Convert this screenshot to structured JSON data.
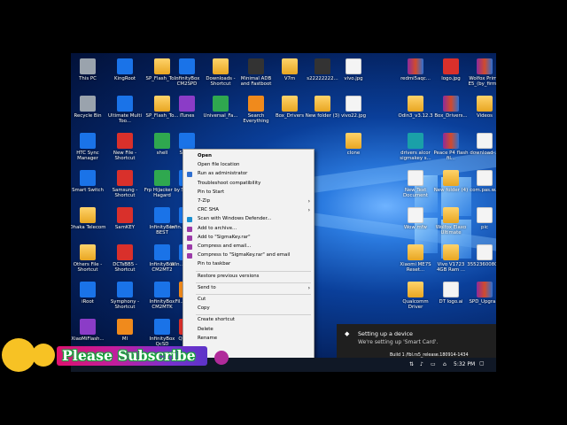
{
  "desktop_icons": [
    {
      "label": "This PC",
      "icon": "computer-icon",
      "style": "g-gray"
    },
    {
      "label": "KingRoot",
      "icon": "king-root-icon",
      "style": "g-blue"
    },
    {
      "label": "SP_Flash_To...",
      "icon": "folder-icon",
      "style": "g-folder"
    },
    {
      "label": "InfinityBox CM2SPD",
      "icon": "infinity-icon",
      "style": "g-blue"
    },
    {
      "label": "Downloads - Shortcut",
      "icon": "folder-icon",
      "style": "g-folder"
    },
    {
      "label": "Minimal ADB and Fastboot",
      "icon": "terminal-icon",
      "style": "g-dark"
    },
    {
      "label": "V7m",
      "icon": "folder-icon",
      "style": "g-folder"
    },
    {
      "label": "s22222222...",
      "icon": "file-icon",
      "style": "g-dark"
    },
    {
      "label": "vivo.jpg",
      "icon": "image-icon",
      "style": "g-file"
    },
    {
      "label": "redmi5aqc...",
      "icon": "rar-icon",
      "style": "g-rar"
    },
    {
      "label": "logo.jpg",
      "icon": "image-icon",
      "style": "g-red"
    },
    {
      "label": "Wolfox Prime E5_(by_firm...",
      "icon": "rar-icon",
      "style": "g-rar"
    },
    {
      "label": "Recycle Bin",
      "icon": "recycle-bin-icon",
      "style": "g-gray"
    },
    {
      "label": "Ultimate Multi Too...",
      "icon": "tool-icon",
      "style": "g-blue"
    },
    {
      "label": "SP_Flash_To...",
      "icon": "folder-icon",
      "style": "g-folder"
    },
    {
      "label": "iTunes",
      "icon": "itunes-icon",
      "style": "g-purple"
    },
    {
      "label": "Universal_Fa...",
      "icon": "app-icon",
      "style": "g-green"
    },
    {
      "label": "Search Everything",
      "icon": "search-icon",
      "style": "g-orange"
    },
    {
      "label": "Box_Drivers",
      "icon": "folder-icon",
      "style": "g-folder"
    },
    {
      "label": "New folder (3)",
      "icon": "folder-icon",
      "style": "g-folder"
    },
    {
      "label": "vivo22.jpg",
      "icon": "image-icon",
      "style": "g-file"
    },
    {
      "label": "Odin3_v3.12.3",
      "icon": "folder-icon",
      "style": "g-folder"
    },
    {
      "label": "Box_Drivers...",
      "icon": "rar-icon",
      "style": "g-rar"
    },
    {
      "label": "Videos",
      "icon": "folder-icon",
      "style": "g-folder"
    },
    {
      "label": "HTC Sync Manager",
      "icon": "htc-icon",
      "style": "g-blue"
    },
    {
      "label": "New File - Shortcut",
      "icon": "file-icon",
      "style": "g-red"
    },
    {
      "label": "shell",
      "icon": "shell-icon",
      "style": "g-green"
    },
    {
      "label": "Sam...",
      "icon": "app-icon",
      "style": "g-blue"
    },
    {
      "label": "clone",
      "icon": "folder-icon",
      "style": "g-folder"
    },
    {
      "label": "drivers alcor sigmakey s...",
      "icon": "disc-icon",
      "style": "g-teal"
    },
    {
      "label": "Peace P4 flash fil...",
      "icon": "rar-icon",
      "style": "g-rar"
    },
    {
      "label": "download-...",
      "icon": "file-icon",
      "style": "g-file"
    },
    {
      "label": "Smart Switch",
      "icon": "smart-switch-icon",
      "style": "g-blue"
    },
    {
      "label": "Samsung - Shortcut",
      "icon": "samsung-icon",
      "style": "g-red"
    },
    {
      "label": "Frp HiJacker by Hagard",
      "icon": "frp-icon",
      "style": "g-green"
    },
    {
      "label": "Sig...",
      "icon": "sigmakey-icon",
      "style": "g-blue"
    },
    {
      "label": "New Text Document",
      "icon": "file-icon",
      "style": "g-file"
    },
    {
      "label": "New folder (4)",
      "icon": "folder-icon",
      "style": "g-folder"
    },
    {
      "label": "com.pas.w...",
      "icon": "file-icon",
      "style": "g-file"
    },
    {
      "label": "Dhaka Telecom",
      "icon": "folder-icon",
      "style": "g-folder"
    },
    {
      "label": "SamKEY",
      "icon": "samkey-icon",
      "style": "g-red"
    },
    {
      "label": "InfinityBox BEST",
      "icon": "infinity-icon",
      "style": "g-blue"
    },
    {
      "label": "Infin... Ultim...",
      "icon": "infinity-icon",
      "style": "g-blue"
    },
    {
      "label": "Wow mfw",
      "icon": "file-icon",
      "style": "g-file"
    },
    {
      "label": "Wolfox Elaxo Ultimate",
      "icon": "folder-icon",
      "style": "g-folder"
    },
    {
      "label": "pic",
      "icon": "file-icon",
      "style": "g-file"
    },
    {
      "label": "Others File - Shortcut",
      "icon": "folder-icon",
      "style": "g-folder"
    },
    {
      "label": "DCTsBB5 - Shortcut",
      "icon": "tool-icon",
      "style": "g-red"
    },
    {
      "label": "InfinityBox CM2MT2",
      "icon": "infinity-icon",
      "style": "g-blue"
    },
    {
      "label": "Win... Devic...",
      "icon": "app-icon",
      "style": "g-blue"
    },
    {
      "label": "Xiaomi ME7S Reset...",
      "icon": "folder-icon",
      "style": "g-folder"
    },
    {
      "label": "Vivo V1723 4GB Ram ...",
      "icon": "folder-icon",
      "style": "g-folder"
    },
    {
      "label": "3552360080...",
      "icon": "file-icon",
      "style": "g-file"
    },
    {
      "label": "iRoot",
      "icon": "iroot-icon",
      "style": "g-blue"
    },
    {
      "label": "Symphony - Shortcut",
      "icon": "symphony-icon",
      "style": "g-blue"
    },
    {
      "label": "InfinityBox CM2MTK",
      "icon": "infinity-icon",
      "style": "g-blue"
    },
    {
      "label": "Fil... Bro...",
      "icon": "app-icon",
      "style": "g-orange"
    },
    {
      "label": "Qualcomm Driver",
      "icon": "qualcomm-icon",
      "style": "g-folder"
    },
    {
      "label": "DT logo.ai",
      "icon": "file-icon",
      "style": "g-file"
    },
    {
      "label": "SPD_Upgra...",
      "icon": "rar-icon",
      "style": "g-rar"
    },
    {
      "label": "XiaoMiFlash...",
      "icon": "mi-flash-icon",
      "style": "g-purple"
    },
    {
      "label": "MI",
      "icon": "mi-icon",
      "style": "g-orange"
    },
    {
      "label": "InfinityBox QcSD",
      "icon": "infinity-icon",
      "style": "g-blue"
    },
    {
      "label": "QSDP...",
      "icon": "app-icon",
      "style": "g-red"
    }
  ],
  "context_menu": {
    "items": [
      {
        "label": "Open",
        "bold": true
      },
      {
        "label": "Open file location"
      },
      {
        "label": "Run as administrator",
        "icon": "shield-icon"
      },
      {
        "label": "Troubleshoot compatibility"
      },
      {
        "label": "Pin to Start"
      },
      {
        "label": "7-Zip",
        "submenu": true
      },
      {
        "label": "CRC SHA",
        "submenu": true
      },
      {
        "label": "Scan with Windows Defender...",
        "icon": "defender-icon"
      },
      {
        "label": "Add to archive...",
        "icon": "winrar-icon"
      },
      {
        "label": "Add to \"SigmaKey.rar\"",
        "icon": "winrar-icon"
      },
      {
        "label": "Compress and email...",
        "icon": "winrar-icon"
      },
      {
        "label": "Compress to \"SigmaKey.rar\" and email",
        "icon": "winrar-icon"
      },
      {
        "label": "Pin to taskbar"
      },
      {
        "label": "Restore previous versions"
      },
      {
        "label": "Send to",
        "submenu": true
      },
      {
        "label": "Cut"
      },
      {
        "label": "Copy"
      },
      {
        "label": "Create shortcut"
      },
      {
        "label": "Delete"
      },
      {
        "label": "Rename"
      }
    ],
    "arrow": "›"
  },
  "toast": {
    "title": "Setting up a device",
    "message": "We're setting up 'Smart Card'."
  },
  "build_text": "Build 1 /fbl.rs5_release.180914-1434",
  "clock": "5:32 PM",
  "overlay": {
    "subscribe_text": "Please Subscribe"
  },
  "colors": {
    "accent_pink": "#e01070",
    "accent_purple": "#7c2fd0",
    "subscribe_outline": "#16a33a",
    "circle_yellow": "#f7c224"
  }
}
